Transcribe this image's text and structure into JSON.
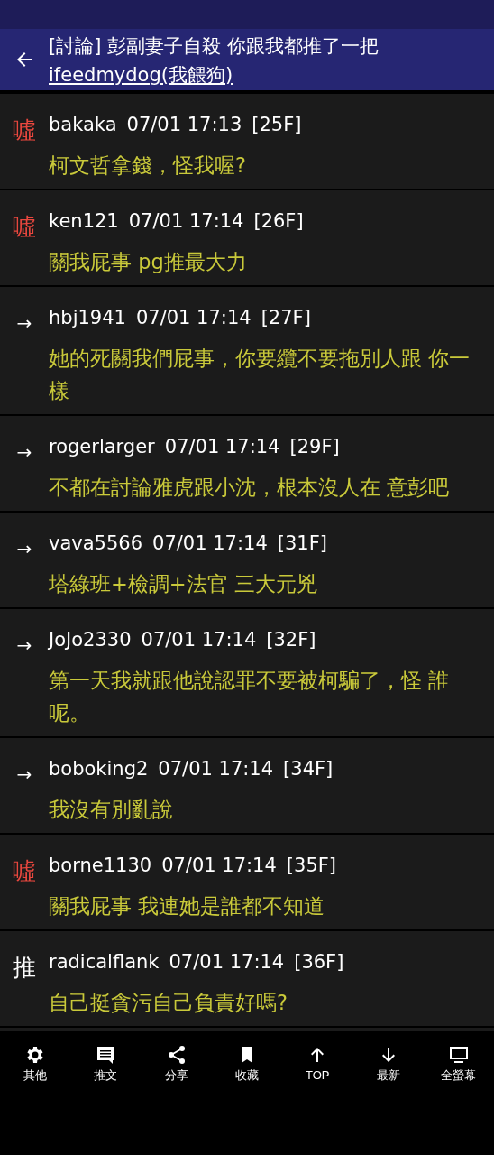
{
  "header": {
    "title": "[討論] 彭副妻子自殺 你跟我都推了一把",
    "author": "ifeedmydog(我餵狗)"
  },
  "comments": [
    {
      "kind": "boo",
      "tag": "噓",
      "user": "bakaka",
      "time": "07/01 17:13",
      "floor": "[25F]",
      "text": "柯文哲拿錢，怪我喔?"
    },
    {
      "kind": "boo",
      "tag": "噓",
      "user": "ken121",
      "time": "07/01 17:14",
      "floor": "[26F]",
      "text": "關我屁事 pg推最大力"
    },
    {
      "kind": "arrow",
      "tag": "→",
      "user": "hbj1941",
      "time": "07/01 17:14",
      "floor": "[27F]",
      "text": "她的死關我們屁事，你要纜不要拖別人跟 你一樣"
    },
    {
      "kind": "arrow",
      "tag": "→",
      "user": "rogerlarger",
      "time": "07/01 17:14",
      "floor": "[29F]",
      "text": "不都在討論雅虎跟小沈，根本沒人在 意彭吧"
    },
    {
      "kind": "arrow",
      "tag": "→",
      "user": "vava5566",
      "time": "07/01 17:14",
      "floor": "[31F]",
      "text": "塔綠班+檢調+法官 三大元兇"
    },
    {
      "kind": "arrow",
      "tag": "→",
      "user": "JoJo2330",
      "time": "07/01 17:14",
      "floor": "[32F]",
      "text": "第一天我就跟他說認罪不要被柯騙了，怪 誰呢。"
    },
    {
      "kind": "arrow",
      "tag": "→",
      "user": "boboking2",
      "time": "07/01 17:14",
      "floor": "[34F]",
      "text": "我沒有別亂說"
    },
    {
      "kind": "boo",
      "tag": "噓",
      "user": "borne1130",
      "time": "07/01 17:14",
      "floor": "[35F]",
      "text": "關我屁事 我連她是誰都不知道"
    },
    {
      "kind": "push",
      "tag": "推",
      "user": "radicalflank",
      "time": "07/01 17:14",
      "floor": "[36F]",
      "text": "自己挺貪污自己負責好嗎?"
    }
  ],
  "toolbar": [
    {
      "label": "其他"
    },
    {
      "label": "推文"
    },
    {
      "label": "分享"
    },
    {
      "label": "收藏"
    },
    {
      "label": "TOP"
    },
    {
      "label": "最新"
    },
    {
      "label": "全螢幕"
    }
  ]
}
